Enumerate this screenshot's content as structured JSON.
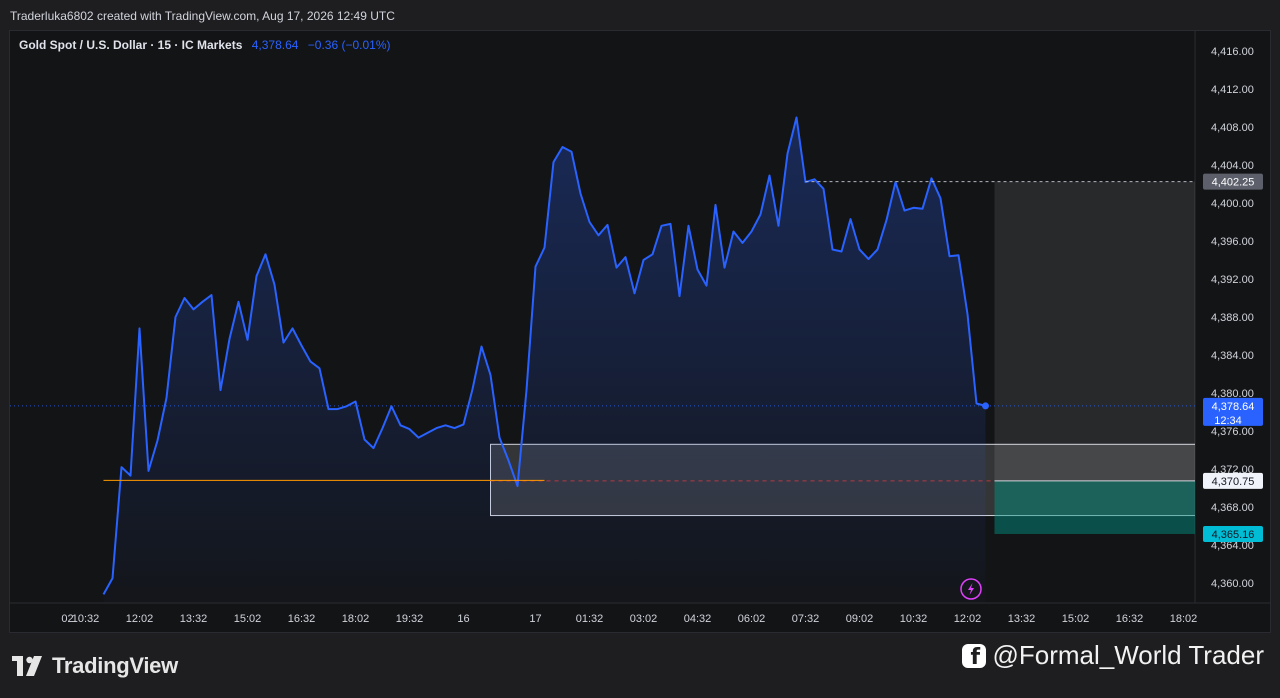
{
  "header": {
    "credit": "Traderluka6802 created with TradingView.com, Aug 17, 2026 12:49 UTC"
  },
  "legend": {
    "symbol": "Gold Spot / U.S. Dollar · 15 · IC Markets",
    "price": "4,378.64",
    "change": "−0.36 (−0.01%)"
  },
  "footer": {
    "brand": "TradingView",
    "handle": "@Formal_World Trader"
  },
  "colors": {
    "line": "#2962ff",
    "stop_level": "#ff9800",
    "price_tag": "#2962ff",
    "target_tag": "#00bcd4",
    "zone_border": "#d1d4dc"
  },
  "icons": [
    "tradingview-logo-icon",
    "facebook-icon",
    "lightning-icon"
  ],
  "chart_data": {
    "type": "line",
    "title": "Gold Spot / U.S. Dollar · 15 · IC Markets",
    "ylim": [
      4358,
      4418
    ],
    "y_ticks": [
      {
        "value": 4416,
        "label": "4,416.00"
      },
      {
        "value": 4412,
        "label": "4,412.00"
      },
      {
        "value": 4408,
        "label": "4,408.00"
      },
      {
        "value": 4404,
        "label": "4,404.00"
      },
      {
        "value": 4400,
        "label": "4,400.00"
      },
      {
        "value": 4396,
        "label": "4,396.00"
      },
      {
        "value": 4392,
        "label": "4,392.00"
      },
      {
        "value": 4388,
        "label": "4,388.00"
      },
      {
        "value": 4384,
        "label": "4,384.00"
      },
      {
        "value": 4380,
        "label": "4,380.00"
      },
      {
        "value": 4376,
        "label": "4,376.00"
      },
      {
        "value": 4372,
        "label": "4,372.00"
      },
      {
        "value": 4368,
        "label": "4,368.00"
      },
      {
        "value": 4364,
        "label": "4,364.00"
      },
      {
        "value": 4360,
        "label": "4,360.00"
      }
    ],
    "x_ticks": [
      {
        "index": -1,
        "label": "02"
      },
      {
        "index": 1,
        "label": "10:32"
      },
      {
        "index": 7,
        "label": "12:02"
      },
      {
        "index": 13,
        "label": "13:32"
      },
      {
        "index": 19,
        "label": "15:02"
      },
      {
        "index": 25,
        "label": "16:32"
      },
      {
        "index": 31,
        "label": "18:02"
      },
      {
        "index": 37,
        "label": "19:32"
      },
      {
        "index": 43,
        "label": "16"
      },
      {
        "index": 51,
        "label": "17"
      },
      {
        "index": 57,
        "label": "01:32"
      },
      {
        "index": 63,
        "label": "03:02"
      },
      {
        "index": 69,
        "label": "04:32"
      },
      {
        "index": 75,
        "label": "06:02"
      },
      {
        "index": 81,
        "label": "07:32"
      },
      {
        "index": 87,
        "label": "09:02"
      },
      {
        "index": 93,
        "label": "10:32"
      },
      {
        "index": 99,
        "label": "12:02"
      },
      {
        "index": 105,
        "label": "13:32"
      },
      {
        "index": 111,
        "label": "15:02"
      },
      {
        "index": 117,
        "label": "16:32"
      },
      {
        "index": 123,
        "label": "18:02"
      }
    ],
    "x_index_range": [
      -6,
      128
    ],
    "series": [
      {
        "x": [
          3,
          4,
          5,
          6,
          7,
          8,
          9,
          10,
          11,
          12,
          13,
          14,
          15,
          16,
          17,
          18,
          19,
          20,
          21,
          22,
          23,
          24,
          25,
          26,
          27,
          28,
          29,
          30,
          31,
          32,
          33,
          34,
          35,
          36,
          37,
          38,
          39,
          40,
          41,
          42,
          43,
          44,
          45,
          46,
          47,
          48,
          49,
          50,
          51,
          52,
          53,
          54,
          55,
          56,
          57,
          58,
          59,
          60,
          61,
          62,
          63,
          64,
          65,
          66,
          67,
          68,
          69,
          70,
          71,
          72,
          73,
          74,
          75,
          76,
          77,
          78,
          79,
          80,
          81,
          82,
          83,
          84,
          85,
          86,
          87,
          88,
          89,
          90,
          91,
          92,
          93,
          94,
          95,
          96,
          97,
          98,
          99,
          100,
          101
        ],
        "values": [
          4358.8,
          4360.5,
          4372.2,
          4371.3,
          4386.8,
          4371.8,
          4375.0,
          4379.5,
          4388.0,
          4390.0,
          4388.8,
          4389.6,
          4390.3,
          4380.3,
          4385.7,
          4389.6,
          4385.6,
          4392.3,
          4394.6,
          4391.4,
          4385.3,
          4386.8,
          4385.0,
          4383.3,
          4382.6,
          4378.3,
          4378.3,
          4378.6,
          4379.1,
          4375.1,
          4374.2,
          4376.3,
          4378.6,
          4376.6,
          4376.2,
          4375.3,
          4375.8,
          4376.3,
          4376.6,
          4376.3,
          4376.7,
          4380.4,
          4384.9,
          4381.9,
          4375.3,
          4372.9,
          4370.2,
          4380.3,
          4393.3,
          4395.3,
          4404.3,
          4405.9,
          4405.4,
          4401.0,
          4398.0,
          4396.6,
          4397.7,
          4393.2,
          4394.3,
          4390.5,
          4394.0,
          4394.6,
          4397.6,
          4397.8,
          4390.2,
          4397.6,
          4393.0,
          4391.3,
          4399.8,
          4393.2,
          4397.0,
          4395.8,
          4397.0,
          4398.8,
          4402.9,
          4397.6,
          4405.2,
          4409.0,
          4402.2,
          4402.5,
          4401.5,
          4395.1,
          4394.9,
          4398.3,
          4395.1,
          4394.1,
          4395.1,
          4398.2,
          4402.2,
          4399.2,
          4399.5,
          4399.4,
          4402.6,
          4400.5,
          4394.4,
          4394.5,
          4388.3,
          4378.9,
          4378.64
        ]
      }
    ],
    "current_price": {
      "value": 4378.64,
      "label": "4,378.64",
      "countdown": "12:34"
    },
    "levels": [
      {
        "name": "entry",
        "value": 4370.75,
        "label": "4,370.75"
      },
      {
        "name": "stop",
        "value": 4402.25,
        "label": "4,402.25"
      },
      {
        "name": "target",
        "value": 4365.16,
        "label": "4,365.16"
      },
      {
        "name": "support-line",
        "value": 4370.8,
        "from": 3,
        "to": 52
      }
    ],
    "zones": [
      {
        "name": "demand-zone",
        "from": 46,
        "to": 125,
        "top": 4374.6,
        "bottom": 4367.1
      },
      {
        "name": "risk-zone",
        "from": 102,
        "to": 125,
        "top": 4402.25,
        "bottom": 4370.75
      },
      {
        "name": "reward-zone",
        "from": 102,
        "to": 125,
        "top": 4370.75,
        "bottom": 4365.16
      }
    ]
  }
}
